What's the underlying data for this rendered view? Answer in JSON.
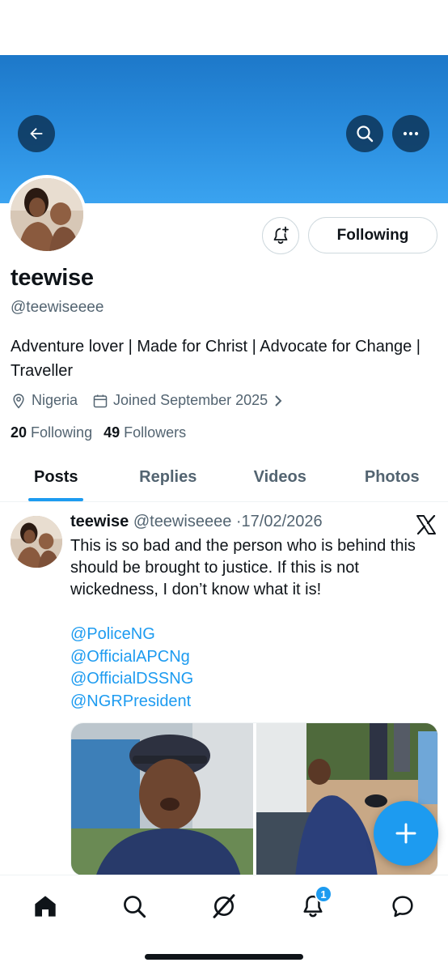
{
  "profile": {
    "display_name": "teewise",
    "handle": "@teewiseeee",
    "bio": "Adventure lover | Made for Christ | Advocate for Change | Traveller",
    "location": "Nigeria",
    "joined": "Joined September 2025",
    "following_count": "20",
    "following_label": "Following",
    "followers_count": "49",
    "followers_label": "Followers"
  },
  "header": {
    "back_icon": "arrow-left-icon",
    "search_icon": "search-icon",
    "more_icon": "more-icon",
    "banner_color": "#2b8fe0"
  },
  "actions": {
    "notify_icon": "bell-plus-icon",
    "following_label": "Following"
  },
  "tabs": [
    {
      "label": "Posts",
      "active": true
    },
    {
      "label": "Replies",
      "active": false
    },
    {
      "label": "Videos",
      "active": false
    },
    {
      "label": "Photos",
      "active": false
    }
  ],
  "post": {
    "author_name": "teewise",
    "author_handle": "@teewiseeee",
    "separator": "·",
    "date": "17/02/2026",
    "text": "This is so bad and the person who is behind this should be brought to justice. If this is not wickedness, I don’t know what it is!",
    "mentions": [
      "@PoliceNG",
      "@OfficialAPCNg",
      "@OfficialDSSNG",
      "@NGRPresident"
    ],
    "platform_icon": "x-logo-icon"
  },
  "fab": {
    "icon": "plus-icon",
    "color": "#1d9bf0"
  },
  "bottom_nav": {
    "items": [
      "home-icon",
      "search-icon",
      "grok-icon",
      "bell-icon",
      "messages-icon"
    ],
    "notification_badge": "1"
  },
  "colors": {
    "accent": "#1d9bf0",
    "text": "#0f1419",
    "secondary": "#536471"
  }
}
